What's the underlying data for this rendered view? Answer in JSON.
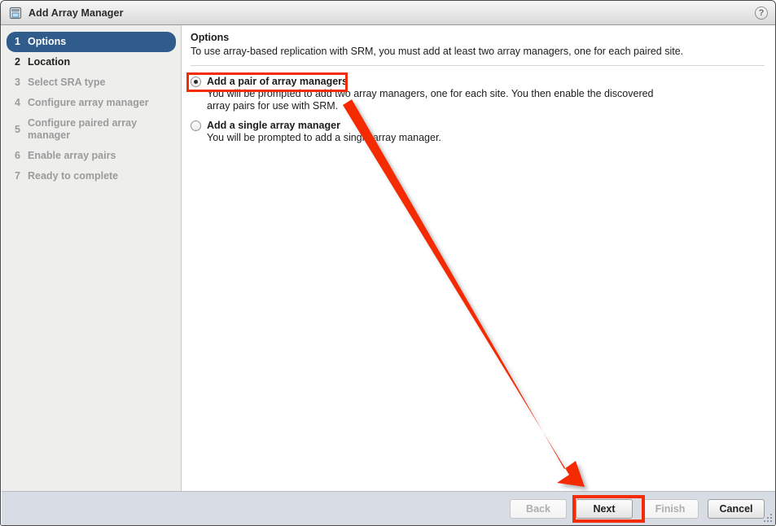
{
  "window": {
    "title": "Add Array Manager",
    "title_icon": "array-manager-icon",
    "help_icon": "?"
  },
  "sidebar": {
    "steps": [
      {
        "num": "1",
        "label": "Options",
        "state": "active"
      },
      {
        "num": "2",
        "label": "Location",
        "state": "enabled"
      },
      {
        "num": "3",
        "label": "Select SRA type",
        "state": "disabled"
      },
      {
        "num": "4",
        "label": "Configure array manager",
        "state": "disabled"
      },
      {
        "num": "5",
        "label": "Configure paired array manager",
        "state": "disabled"
      },
      {
        "num": "6",
        "label": "Enable array pairs",
        "state": "disabled"
      },
      {
        "num": "7",
        "label": "Ready to complete",
        "state": "disabled"
      }
    ]
  },
  "content": {
    "title": "Options",
    "description": "To use array-based replication with SRM, you must add at least two array managers, one for each paired site.",
    "options": [
      {
        "label": "Add a pair of array managers",
        "description": "You will be prompted to add two array managers, one for each site. You then enable the discovered array pairs for use with SRM.",
        "selected": true
      },
      {
        "label": "Add a single array manager",
        "description": "You will be prompted to add a single array manager.",
        "selected": false
      }
    ]
  },
  "footer": {
    "buttons": [
      {
        "label": "Back",
        "enabled": false
      },
      {
        "label": "Next",
        "enabled": true
      },
      {
        "label": "Finish",
        "enabled": false
      },
      {
        "label": "Cancel",
        "enabled": true
      }
    ]
  },
  "annotations": {
    "highlight_color": "#f42c05",
    "arrow": {
      "from_label": "Add a pair of array managers",
      "to_label": "Next"
    }
  }
}
